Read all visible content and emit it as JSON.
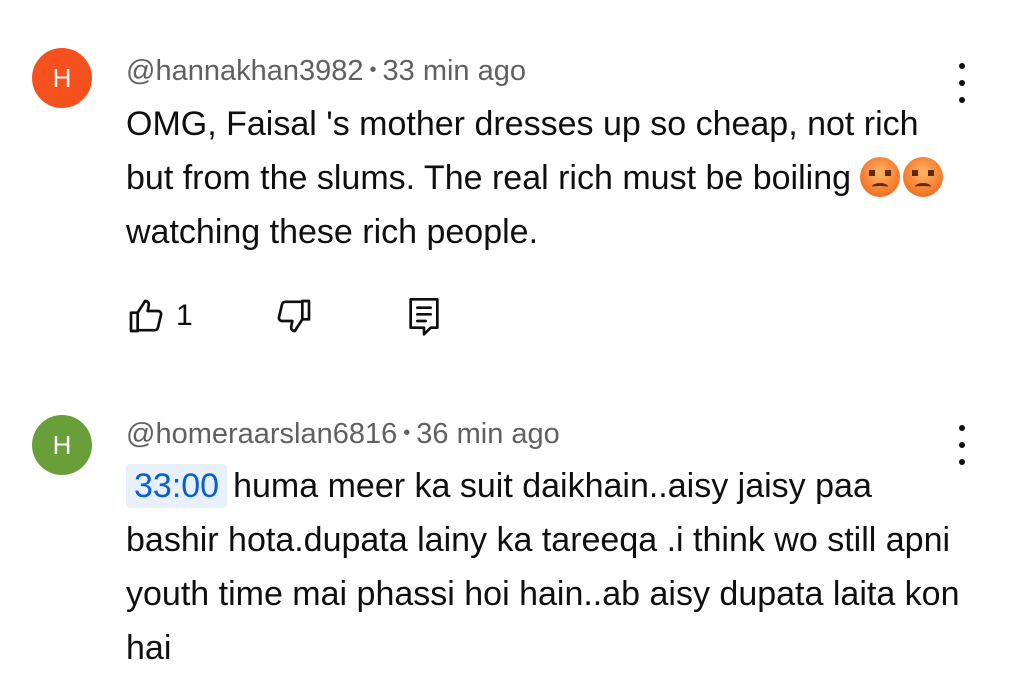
{
  "comments": [
    {
      "avatar_letter": "H",
      "avatar_color": "#f4511e",
      "author": "@hannakhan3982",
      "separator": "•",
      "time_ago": "33 min ago",
      "text_before_emoji": "OMG, Faisal 's mother dresses up so cheap, not rich but from the slums. The real rich must be boiling ",
      "emoji": "😡😡",
      "text_after_emoji": " watching these rich people.",
      "like_count": "1"
    },
    {
      "avatar_letter": "H",
      "avatar_color": "#689f38",
      "author": "@homeraarslan6816",
      "separator": "•",
      "time_ago": "36 min ago",
      "timestamp_link": "33:00",
      "text": "huma meer ka suit daikhain..aisy jaisy paa bashir hota.dupata lainy ka tareeqa .i think wo still apni youth time mai phassi hoi hain..ab aisy dupata laita kon hai"
    }
  ],
  "icons": {
    "like": "thumb-up-icon",
    "dislike": "thumb-down-icon",
    "reply": "comment-reply-icon",
    "more": "more-vertical-icon"
  },
  "colors": {
    "text": "#0f0f0f",
    "meta": "#606060",
    "link": "#065fd4",
    "link_bg": "#e8f1fb"
  }
}
